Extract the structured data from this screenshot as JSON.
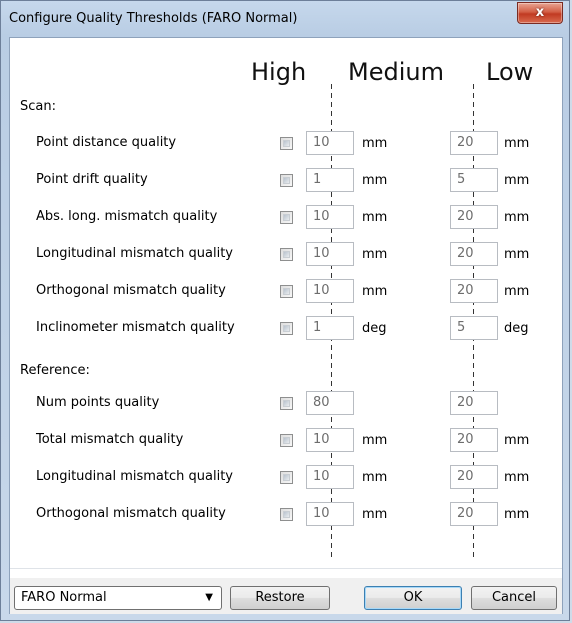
{
  "window": {
    "title": "Configure Quality Thresholds (FARO Normal)",
    "close_label": "x"
  },
  "columns": {
    "high": "High",
    "medium": "Medium",
    "low": "Low"
  },
  "sections": {
    "scan": "Scan:",
    "reference": "Reference:"
  },
  "scan_rows": [
    {
      "label": "Point distance quality",
      "high": "10",
      "high_unit": "mm",
      "low": "20",
      "low_unit": "mm"
    },
    {
      "label": "Point drift quality",
      "high": "1",
      "high_unit": "mm",
      "low": "5",
      "low_unit": "mm"
    },
    {
      "label": "Abs. long. mismatch quality",
      "high": "10",
      "high_unit": "mm",
      "low": "20",
      "low_unit": "mm"
    },
    {
      "label": "Longitudinal mismatch quality",
      "high": "10",
      "high_unit": "mm",
      "low": "20",
      "low_unit": "mm"
    },
    {
      "label": "Orthogonal mismatch quality",
      "high": "10",
      "high_unit": "mm",
      "low": "20",
      "low_unit": "mm"
    },
    {
      "label": "Inclinometer mismatch quality",
      "high": "1",
      "high_unit": "deg",
      "low": "5",
      "low_unit": "deg"
    }
  ],
  "reference_rows": [
    {
      "label": "Num points quality",
      "high": "80",
      "high_unit": "",
      "low": "20",
      "low_unit": ""
    },
    {
      "label": "Total mismatch quality",
      "high": "10",
      "high_unit": "mm",
      "low": "20",
      "low_unit": "mm"
    },
    {
      "label": "Longitudinal mismatch quality",
      "high": "10",
      "high_unit": "mm",
      "low": "20",
      "low_unit": "mm"
    },
    {
      "label": "Orthogonal mismatch quality",
      "high": "10",
      "high_unit": "mm",
      "low": "20",
      "low_unit": "mm"
    }
  ],
  "footer": {
    "preset_selected": "FARO Normal",
    "restore_label": "Restore",
    "ok_label": "OK",
    "cancel_label": "Cancel"
  }
}
